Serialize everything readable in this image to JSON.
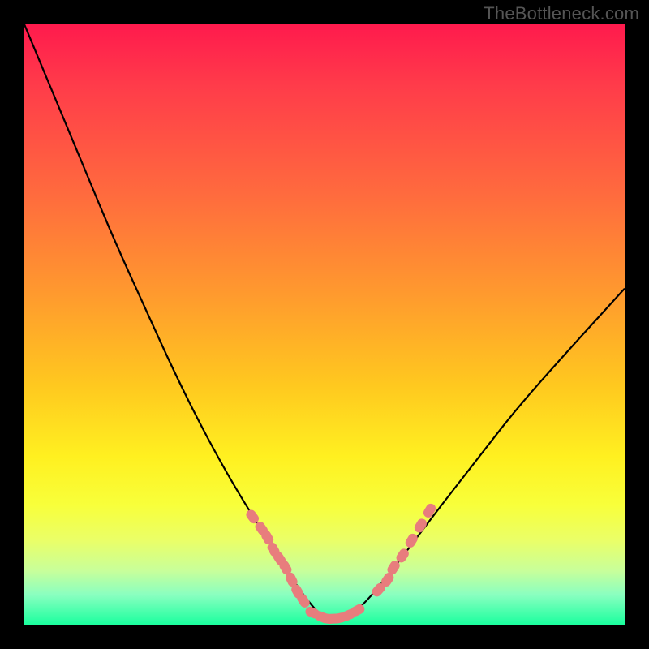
{
  "watermark": "TheBottleneck.com",
  "chart_data": {
    "type": "line",
    "title": "",
    "xlabel": "",
    "ylabel": "",
    "ylim": [
      0,
      1
    ],
    "series": [
      {
        "name": "bottleneck-curve",
        "x": [
          0.0,
          0.05,
          0.1,
          0.15,
          0.2,
          0.25,
          0.3,
          0.35,
          0.4,
          0.45,
          0.48,
          0.5,
          0.52,
          0.55,
          0.58,
          0.62,
          0.68,
          0.75,
          0.82,
          0.9,
          1.0
        ],
        "values": [
          1.0,
          0.88,
          0.76,
          0.64,
          0.53,
          0.42,
          0.32,
          0.23,
          0.15,
          0.07,
          0.03,
          0.01,
          0.01,
          0.02,
          0.05,
          0.1,
          0.18,
          0.27,
          0.36,
          0.45,
          0.56
        ]
      },
      {
        "name": "marker-clusters-left",
        "x": [
          0.38,
          0.395,
          0.405,
          0.415,
          0.425,
          0.435,
          0.445,
          0.455,
          0.465
        ],
        "values": [
          0.18,
          0.16,
          0.145,
          0.125,
          0.11,
          0.095,
          0.075,
          0.055,
          0.04
        ]
      },
      {
        "name": "marker-clusters-bottom",
        "x": [
          0.48,
          0.495,
          0.505,
          0.515,
          0.525,
          0.54,
          0.555
        ],
        "values": [
          0.02,
          0.013,
          0.01,
          0.01,
          0.011,
          0.016,
          0.024
        ]
      },
      {
        "name": "marker-clusters-right",
        "x": [
          0.59,
          0.605,
          0.615,
          0.63,
          0.645,
          0.66,
          0.675
        ],
        "values": [
          0.058,
          0.075,
          0.095,
          0.115,
          0.14,
          0.165,
          0.19
        ]
      }
    ]
  }
}
